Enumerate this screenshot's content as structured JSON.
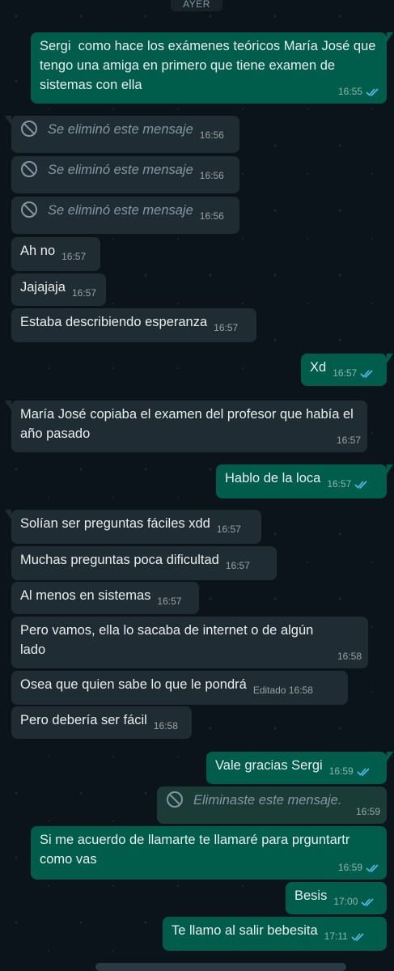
{
  "date_separator": "AYER",
  "colors": {
    "background": "#0b141a",
    "incoming_bubble": "#202c33",
    "outgoing_bubble": "#005c4b",
    "read_ticks": "#53bdeb"
  },
  "messages": [
    {
      "direction": "out",
      "text": "Sergi  como hace los exámenes teóricos María José que tengo una amiga en primero que tiene examen de sistemas con ella",
      "time": "16:55",
      "status": "read"
    },
    {
      "direction": "in",
      "text": "Se eliminó este mensaje",
      "time": "16:56",
      "deleted": true
    },
    {
      "direction": "in",
      "text": "Se eliminó este mensaje",
      "time": "16:56",
      "deleted": true
    },
    {
      "direction": "in",
      "text": "Se eliminó este mensaje",
      "time": "16:56",
      "deleted": true
    },
    {
      "direction": "in",
      "text": "Ah no",
      "time": "16:57"
    },
    {
      "direction": "in",
      "text": "Jajajaja",
      "time": "16:57"
    },
    {
      "direction": "in",
      "text": "Estaba describiendo esperanza",
      "time": "16:57"
    },
    {
      "direction": "out",
      "text": "Xd",
      "time": "16:57",
      "status": "read"
    },
    {
      "direction": "in",
      "text": "María José copiaba el examen del profesor que había el año pasado",
      "time": "16:57"
    },
    {
      "direction": "out",
      "text": "Hablo de la loca",
      "time": "16:57",
      "status": "read"
    },
    {
      "direction": "in",
      "text": "Solían ser preguntas fáciles xdd",
      "time": "16:57"
    },
    {
      "direction": "in",
      "text": "Muchas preguntas poca dificultad",
      "time": "16:57"
    },
    {
      "direction": "in",
      "text": "Al menos en sistemas",
      "time": "16:57"
    },
    {
      "direction": "in",
      "text": "Pero vamos, ella lo sacaba de internet o de algún lado",
      "time": "16:58"
    },
    {
      "direction": "in",
      "text": "Osea que quien sabe lo que le pondrá",
      "time": "Editado 16:58"
    },
    {
      "direction": "in",
      "text": "Pero debería ser fácil",
      "time": "16:58"
    },
    {
      "direction": "out",
      "text": "Vale gracias Sergi",
      "time": "16:59",
      "status": "read"
    },
    {
      "direction": "out",
      "text": "Eliminaste este mensaje.",
      "time": "16:59",
      "deleted": true
    },
    {
      "direction": "out",
      "text": "Si me acuerdo de llamarte te llamaré para prguntartr como vas",
      "time": "16:59",
      "status": "read"
    },
    {
      "direction": "out",
      "text": "Besis",
      "time": "17:00",
      "status": "read"
    },
    {
      "direction": "out",
      "text": "Te llamo al salir bebesita",
      "time": "17:11",
      "status": "read"
    }
  ]
}
